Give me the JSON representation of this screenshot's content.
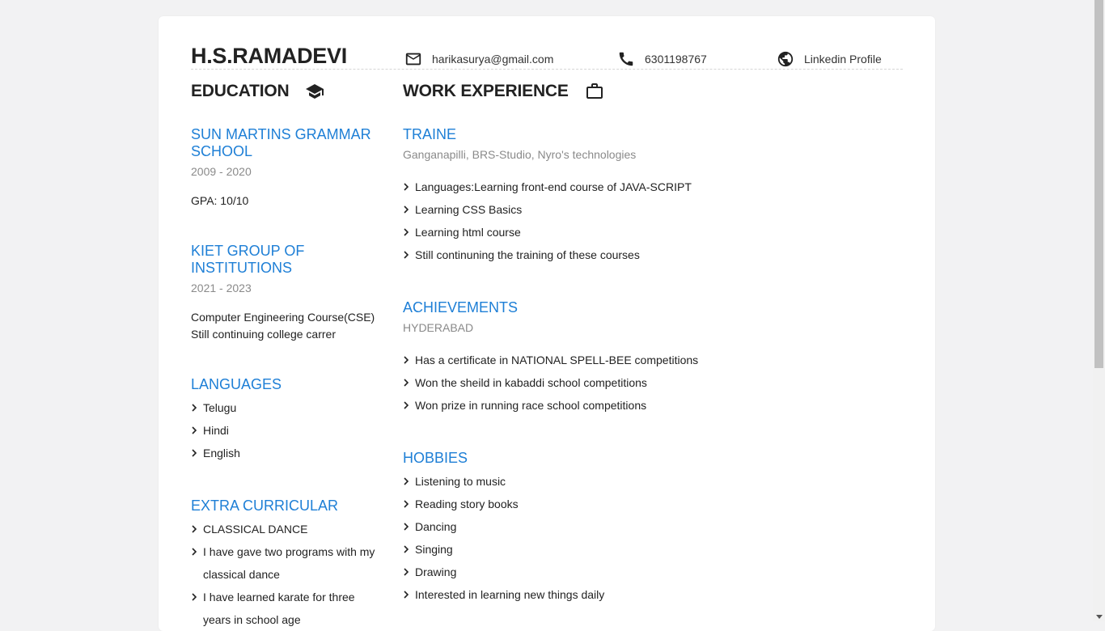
{
  "header": {
    "name": "H.S.RAMADEVI",
    "email": "harikasurya@gmail.com",
    "phone": "6301198767",
    "linkedin": "Linkedin Profile"
  },
  "education": {
    "title": "EDUCATION",
    "schools": [
      {
        "name": "SUN MARTINS GRAMMAR SCHOOL",
        "years": "2009 - 2020",
        "details": [
          "GPA: 10/10"
        ]
      },
      {
        "name": "KIET GROUP OF INSTITUTIONS",
        "years": "2021 - 2023",
        "details": [
          "Computer Engineering Course(CSE)",
          "Still continuing college carrer"
        ]
      }
    ]
  },
  "languages": {
    "title": "LANGUAGES",
    "items": [
      "Telugu",
      "Hindi",
      "English"
    ]
  },
  "extra": {
    "title": "EXTRA CURRICULAR",
    "items": [
      "CLASSICAL DANCE",
      "I have gave two programs with my classical dance",
      "I have learned karate for three years in school age"
    ]
  },
  "work": {
    "title": "WORK EXPERIENCE",
    "role": "TRAINE",
    "place": "Ganganapilli, BRS-Studio, Nyro's technologies",
    "items": [
      "Languages:Learning front-end course of JAVA-SCRIPT",
      "Learning CSS Basics",
      "Learning html course",
      "Still continuning the training of these courses"
    ]
  },
  "achievements": {
    "title": "ACHIEVEMENTS",
    "place": "HYDERABAD",
    "items": [
      "Has a certificate in NATIONAL SPELL-BEE competitions",
      "Won the sheild in kabaddi school competitions",
      "Won prize in running race school competitions"
    ]
  },
  "hobbies": {
    "title": "HOBBIES",
    "items": [
      "Listening to music",
      "Reading story books",
      "Dancing",
      "Singing",
      "Drawing",
      "Interested in learning new things daily"
    ]
  }
}
